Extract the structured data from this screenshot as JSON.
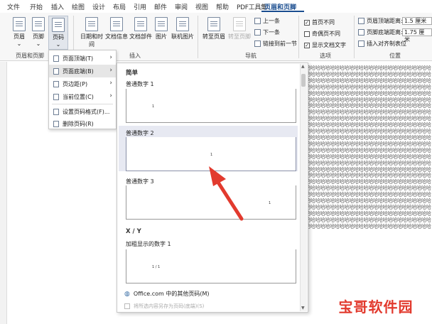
{
  "tabs": [
    "文件",
    "开始",
    "插入",
    "绘图",
    "设计",
    "布局",
    "引用",
    "邮件",
    "审阅",
    "视图",
    "帮助",
    "PDF工具集",
    "页眉和页脚"
  ],
  "ribbon": {
    "header_footer_group": {
      "label": "页眉和页脚",
      "buttons": [
        "页眉",
        "页脚",
        "页码"
      ]
    },
    "insert_group": {
      "label": "插入",
      "buttons": [
        "日期和时间",
        "文档信息",
        "文档部件",
        "图片",
        "联机图片"
      ]
    },
    "nav_group": {
      "label": "导航",
      "goto_header": "转至页眉",
      "goto_footer": "转至页脚",
      "prev": "上一条",
      "next": "下一条",
      "link_prev": "链接到前一节"
    },
    "options_group": {
      "label": "选项",
      "options": [
        {
          "label": "首页不同",
          "checked": true
        },
        {
          "label": "奇偶页不同",
          "checked": false
        },
        {
          "label": "显示文档文字",
          "checked": true
        }
      ]
    },
    "position_group": {
      "label": "位置",
      "header_dist_label": "页眉顶端距离:",
      "header_dist_value": "1.5 厘米",
      "footer_dist_label": "页脚底端距离:",
      "footer_dist_value": "1.75 厘米",
      "insert_align_tab": "插入对齐制表位"
    }
  },
  "menu": {
    "items": [
      {
        "label": "页面顶端(T)",
        "submenu": true
      },
      {
        "label": "页面底端(B)",
        "submenu": true
      },
      {
        "label": "页边距(P)",
        "submenu": true
      },
      {
        "label": "当前位置(C)",
        "submenu": true
      },
      {
        "label": "设置页码格式(F)...",
        "submenu": false
      },
      {
        "label": "删除页码(R)",
        "submenu": false
      }
    ]
  },
  "gallery": {
    "section_simple": "简单",
    "section_xy": "X / Y",
    "items": [
      {
        "name": "普通数字 1",
        "sample": "1"
      },
      {
        "name": "普通数字 2",
        "sample": "1"
      },
      {
        "name": "普通数字 3",
        "sample": "1"
      },
      {
        "name": "加粗显示的数字 1",
        "sample": "1 / 1"
      }
    ],
    "more_label": "Office.com 中的其他页码(M)",
    "save_label": "将所选内容另存为页码(底端)(S)"
  },
  "doc": {
    "filler": "哈哈哈哈哈哈哈哈哈哈哈哈哈哈哈哈哈哈哈哈哈哈哈哈哈哈哈哈哈哈哈哈哈哈哈哈哈哈哈哈哈哈哈哈哈哈哈哈哈哈哈哈哈哈哈哈哈哈哈哈哈哈哈哈哈哈哈哈哈哈哈哈哈哈哈哈哈哈哈哈哈哈哈哈哈哈哈哈哈哈哈哈哈哈哈哈哈哈哈哈哈哈哈哈哈哈哈哈哈哈哈哈哈哈哈哈哈哈哈哈哈哈哈哈哈哈哈哈哈哈哈哈哈哈哈哈哈哈哈哈哈哈哈哈哈哈哈哈哈哈哈哈哈哈哈哈哈哈哈哈哈哈哈哈哈哈哈哈哈哈哈哈哈哈哈哈哈哈哈哈哈哈哈哈哈哈哈哈哈哈哈哈哈哈哈哈哈哈哈哈哈哈哈哈哈哈哈哈哈哈哈哈哈哈哈哈哈哈哈哈哈哈哈哈哈哈哈哈哈哈哈哈哈哈哈哈哈哈哈哈哈哈哈哈哈哈哈哈哈哈哈哈哈哈哈哈哈哈哈哈哈哈哈哈哈哈哈哈哈哈哈哈哈哈哈哈哈哈哈哈哈哈哈哈哈哈哈哈哈哈哈哈哈哈哈哈哈哈哈哈哈哈哈哈哈哈哈哈哈哈哈哈哈哈哈哈哈哈哈哈哈哈哈哈哈哈哈哈哈哈哈哈哈哈哈哈哈哈哈哈哈哈哈哈哈哈哈哈哈哈哈哈哈哈哈哈哈哈哈哈哈哈哈哈哈哈哈哈哈哈哈哈哈哈哈哈哈哈哈哈哈哈哈哈哈哈哈哈哈哈哈哈哈哈哈哈哈哈哈哈哈哈哈哈哈哈哈哈哈哈哈哈哈哈哈哈哈哈哈哈哈哈哈哈哈哈哈哈哈哈哈哈哈哈哈哈哈哈哈哈哈哈哈哈哈哈哈哈哈哈哈哈哈哈哈哈哈哈哈哈哈哈哈哈哈哈哈哈哈哈哈哈哈哈哈哈哈哈哈哈哈哈哈哈哈哈哈哈哈哈哈哈哈哈哈哈哈哈哈哈哈哈哈哈哈哈哈哈哈哈哈哈哈哈哈哈哈哈哈哈哈哈哈哈哈哈哈哈哈哈哈哈哈哈哈哈哈哈哈哈哈哈哈哈哈哈哈哈哈哈哈哈哈哈哈哈哈哈哈哈哈哈哈哈哈哈哈哈哈哈哈哈哈哈哈哈哈哈哈哈哈哈哈哈哈哈哈哈哈哈哈哈哈哈哈哈哈哈哈哈哈哈哈哈哈哈哈哈哈哈哈哈哈哈哈哈哈哈哈哈哈哈哈哈哈哈哈哈哈哈哈哈哈哈哈哈哈哈哈哈哈哈哈哈哈哈哈哈哈哈哈哈哈哈哈哈哈哈哈哈哈哈哈哈哈哈哈哈哈哈哈哈哈哈哈哈"
  },
  "watermark": "宝哥软件园",
  "colors": {
    "accent": "#1a4d8f",
    "arrow": "#e23a2e",
    "highlight": "#e7e9f2"
  }
}
